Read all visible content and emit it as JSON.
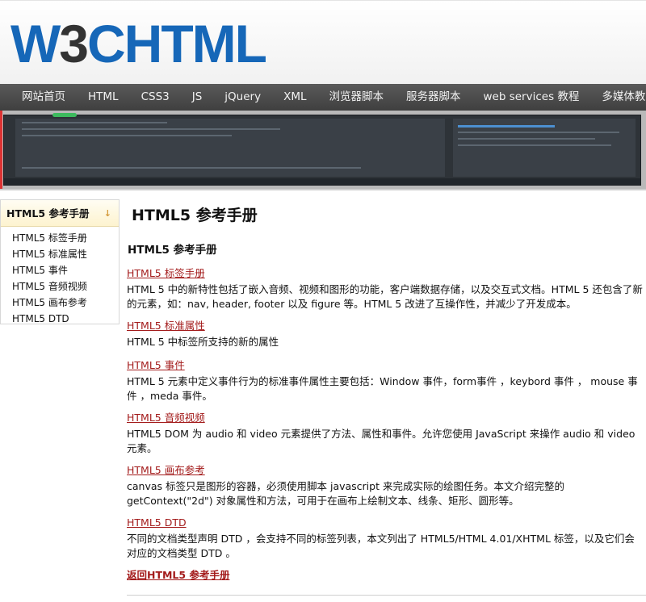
{
  "header": {
    "logo_part1": "W",
    "logo_part2": "3",
    "logo_part3": "CHTML"
  },
  "nav": {
    "items": [
      "网站首页",
      "HTML",
      "CSS3",
      "JS",
      "jQuery",
      "XML",
      "浏览器脚本",
      "服务器脚本",
      "web services 教程",
      "多媒体教"
    ]
  },
  "sidebar": {
    "title": "HTML5 参考手册",
    "items": [
      "HTML5 标签手册",
      "HTML5 标准属性",
      "HTML5 事件",
      "HTML5 音频视频",
      "HTML5 画布参考",
      "HTML5 DTD"
    ]
  },
  "main": {
    "page_title": "HTML5 参考手册",
    "sub_title": "HTML5 参考手册",
    "entries": [
      {
        "link": "HTML5 标签手册",
        "desc": "HTML 5 中的新特性包括了嵌入音频、视频和图形的功能，客户端数据存储，以及交互式文档。HTML 5 还包含了新的元素，如：nav, header, footer 以及 figure 等。HTML 5 改进了互操作性，并减少了开发成本。"
      },
      {
        "link": "HTML5 标准属性",
        "desc": "HTML 5 中标签所支持的新的属性"
      },
      {
        "link": "HTML5 事件",
        "desc": "HTML 5 元素中定义事件行为的标准事件属性主要包括：Window 事件，form事件 ，keybord 事件 ， mouse 事件 ，meda 事件。"
      },
      {
        "link": "HTML5 音频视频",
        "desc": "HTML5 DOM 为 audio 和 video 元素提供了方法、属性和事件。允许您使用 JavaScript 来操作 audio 和 video 元素。"
      },
      {
        "link": "HTML5 画布参考",
        "desc": "canvas 标签只是图形的容器，必须使用脚本 javascript 来完成实际的绘图任务。本文介绍完整的 getContext(\"2d\") 对象属性和方法，可用于在画布上绘制文本、线条、矩形、圆形等。"
      },
      {
        "link": "HTML5 DTD",
        "desc": "不同的文档类型声明 DTD ，会支持不同的标签列表，本文列出了 HTML5/HTML 4.01/XHTML 标签，以及它们会对应的文档类型 DTD 。"
      }
    ],
    "back_link": "返回HTML5 参考手册"
  }
}
